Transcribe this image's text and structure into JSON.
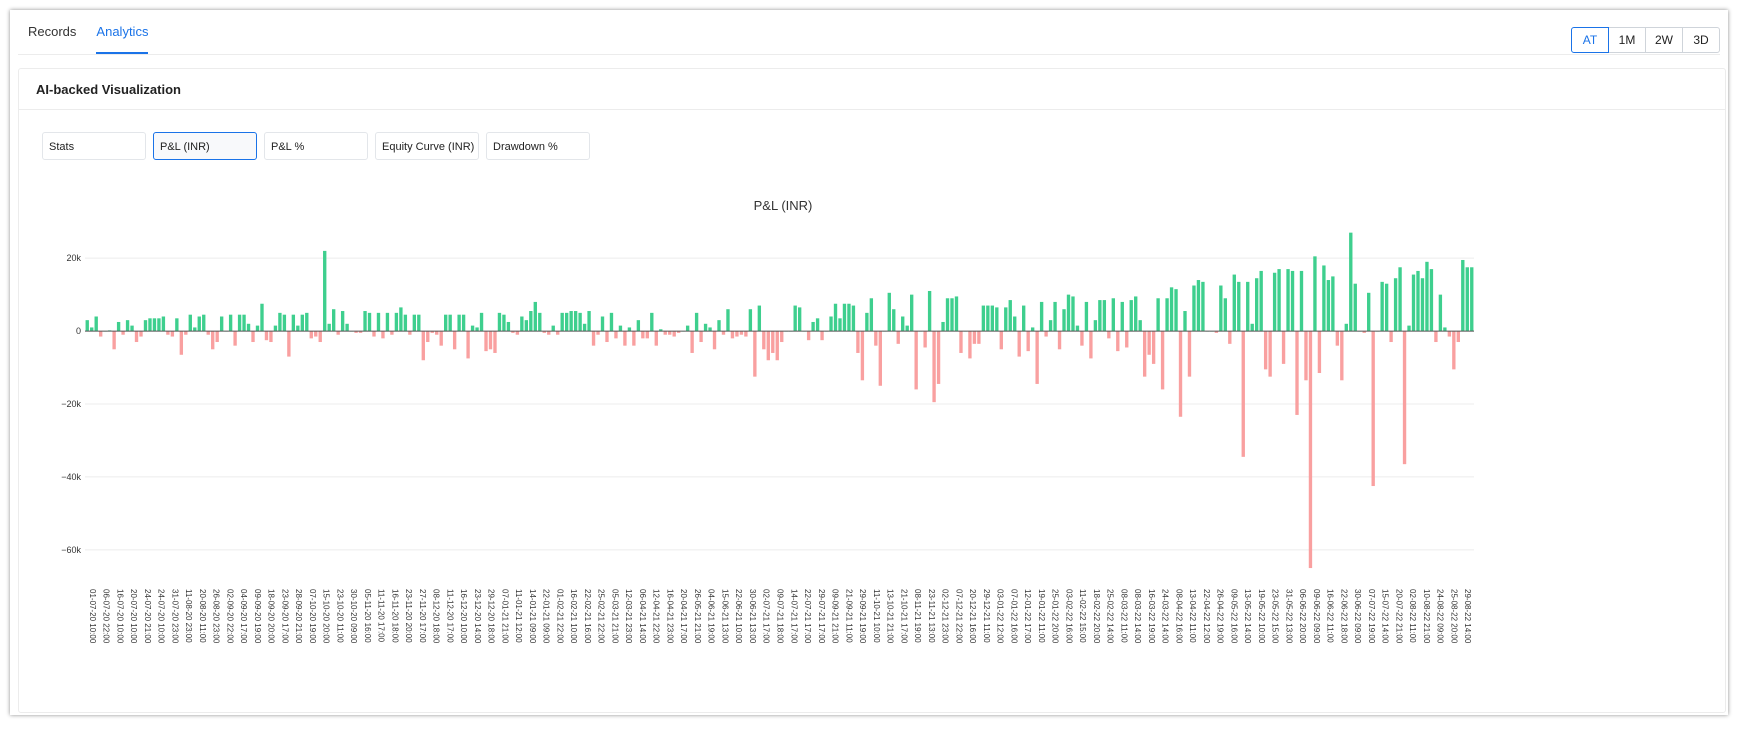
{
  "top_tabs": [
    "Records",
    "Analytics"
  ],
  "active_top_tab": 1,
  "range_buttons": [
    "AT",
    "1M",
    "2W",
    "3D"
  ],
  "active_range": 0,
  "card_title": "AI-backed Visualization",
  "sub_tabs": [
    "Stats",
    "P&L (INR)",
    "P&L %",
    "Equity Curve (INR)",
    "Drawdown %"
  ],
  "active_sub_tab": 1,
  "colors": {
    "accent": "#1a73e8",
    "positive": "#3ecf8e",
    "negative": "#f9a0a0"
  },
  "chart_data": {
    "type": "bar",
    "title": "P&L (INR)",
    "xlabel": "",
    "ylabel": "",
    "ylim": [
      -68000,
      28000
    ],
    "yticks": [
      20000,
      0,
      -20000,
      -40000,
      -60000
    ],
    "ytick_labels": [
      "20k",
      "0",
      "−20k",
      "−40k",
      "−60k"
    ],
    "grid": true,
    "xtick_labels": [
      "01-07-20 10:00",
      "06-07-20 22:00",
      "16-07-20 10:00",
      "20-07-20 10:00",
      "24-07-20 21:00",
      "24-07-20 10:00",
      "31-07-20 23:00",
      "11-08-20 23:00",
      "20-08-20 11:00",
      "26-08-20 23:00",
      "02-09-20 22:00",
      "04-09-20 17:00",
      "09-09-20 19:00",
      "18-09-20 20:00",
      "23-09-20 17:00",
      "28-09-20 21:00",
      "07-10-20 19:00",
      "15-10-20 20:00",
      "23-10-20 11:00",
      "30-10-20 09:00",
      "05-11-20 16:00",
      "11-11-20 17:00",
      "16-11-20 18:00",
      "23-11-20 20:00",
      "27-11-20 17:00",
      "08-12-20 18:00",
      "11-12-20 17:00",
      "16-12-20 10:00",
      "23-12-20 14:00",
      "29-12-20 18:00",
      "07-01-21 21:00",
      "11-01-21 12:00",
      "14-01-21 09:00",
      "22-01-21 09:00",
      "01-02-21 22:00",
      "16-02-21 10:00",
      "22-02-21 16:00",
      "25-02-21 22:00",
      "05-03-21 21:00",
      "12-03-21 23:00",
      "06-04-21 14:00",
      "12-04-21 22:00",
      "16-04-21 23:00",
      "20-04-21 17:00",
      "26-05-21 21:00",
      "04-06-21 19:00",
      "15-06-21 13:00",
      "22-06-21 10:00",
      "30-06-21 13:00",
      "02-07-21 17:00",
      "09-07-21 18:00",
      "14-07-21 17:00",
      "22-07-21 17:00",
      "29-07-21 17:00",
      "09-09-21 21:00",
      "21-09-21 11:00",
      "29-09-21 19:00",
      "11-10-21 10:00",
      "13-10-21 21:00",
      "21-10-21 17:00",
      "08-11-21 19:00",
      "23-11-21 13:00",
      "02-12-21 23:00",
      "07-12-21 22:00",
      "20-12-21 16:00",
      "29-12-21 11:00",
      "03-01-22 12:00",
      "07-01-22 16:00",
      "12-01-22 17:00",
      "19-01-22 11:00",
      "25-01-22 20:00",
      "03-02-22 16:00",
      "11-02-22 15:00",
      "18-02-22 20:00",
      "25-02-22 14:00",
      "08-03-22 11:00",
      "08-03-22 14:00",
      "16-03-22 19:00",
      "24-03-22 14:00",
      "08-04-22 16:00",
      "13-04-22 11:00",
      "22-04-22 12:00",
      "26-04-22 19:00",
      "09-05-22 16:00",
      "13-05-22 14:00",
      "19-05-22 10:00",
      "23-05-22 15:00",
      "31-05-22 13:00",
      "06-06-22 20:00",
      "09-06-22 09:00",
      "16-06-22 11:00",
      "22-06-22 18:00",
      "30-06-22 09:00",
      "07-07-22 19:00",
      "15-07-22 14:00",
      "20-07-22 21:00",
      "02-08-22 11:00",
      "10-08-22 21:00",
      "24-08-22 09:00",
      "25-08-22 20:00",
      "29-08-22 14:00"
    ],
    "values": [
      3000,
      1000,
      4000,
      -1500,
      0,
      200,
      -5000,
      2500,
      -1000,
      3000,
      1500,
      -3000,
      -1500,
      3000,
      3500,
      3500,
      3500,
      4000,
      -1000,
      -1500,
      3500,
      -6500,
      -1000,
      4500,
      1000,
      4000,
      4500,
      -1000,
      -5000,
      -3000,
      4000,
      0,
      4500,
      -4000,
      4500,
      4500,
      2000,
      -3000,
      1500,
      7500,
      -2500,
      -3000,
      1500,
      5000,
      4500,
      -7000,
      4500,
      1500,
      4500,
      5000,
      -2000,
      -1500,
      -3000,
      22000,
      2000,
      6000,
      -1000,
      5500,
      2000,
      0,
      -500,
      -500,
      5500,
      5000,
      -1500,
      5000,
      -2000,
      5000,
      -1000,
      5000,
      6500,
      4500,
      -1000,
      4500,
      4500,
      -8000,
      -3000,
      -500,
      -1000,
      -4000,
      4500,
      4500,
      -5000,
      4500,
      4500,
      -7500,
      1500,
      1000,
      5000,
      -5500,
      -5000,
      -6000,
      5000,
      4500,
      2500,
      -500,
      -1000,
      4000,
      3000,
      5500,
      8000,
      5000,
      -500,
      -1000,
      1500,
      -1000,
      5000,
      5000,
      5500,
      5500,
      5000,
      2000,
      5500,
      -4000,
      -1000,
      4000,
      -3000,
      5000,
      -2000,
      1500,
      -4000,
      1000,
      -4000,
      3000,
      -2000,
      -2000,
      5000,
      -4000,
      500,
      -1000,
      -1000,
      -1500,
      -500,
      0,
      1500,
      -6000,
      5000,
      -3000,
      2000,
      1000,
      -5000,
      3000,
      -1000,
      6000,
      -2000,
      -1500,
      -1000,
      -1500,
      6000,
      -12500,
      7000,
      -5000,
      -8000,
      -6000,
      -8000,
      -3000,
      0,
      0,
      7000,
      6500,
      0,
      -2500,
      2500,
      3500,
      -2500,
      0,
      4000,
      7500,
      3500,
      7500,
      7500,
      7000,
      -6000,
      -13500,
      5000,
      9000,
      -4000,
      -15000,
      0,
      10500,
      6000,
      -3500,
      4000,
      1500,
      10000,
      -16000,
      0,
      -4500,
      11000,
      -19500,
      -14500,
      2500,
      9000,
      9000,
      9500,
      -6000,
      0,
      -7500,
      -3500,
      -3500,
      7000,
      7000,
      7000,
      6500,
      -5000,
      6500,
      8500,
      4000,
      -7000,
      7000,
      -5500,
      1000,
      -14500,
      8000,
      -1500,
      3000,
      8000,
      -5000,
      6000,
      10000,
      9500,
      1500,
      -4000,
      8000,
      -7500,
      3000,
      8500,
      8500,
      -2000,
      9000,
      -5500,
      8000,
      -4500,
      8500,
      9500,
      3000,
      -12500,
      -6500,
      -9000,
      9000,
      -16000,
      9000,
      12000,
      11500,
      -23500,
      5500,
      -12500,
      12500,
      14000,
      13500,
      0,
      0,
      -500,
      12500,
      9000,
      -3500,
      15500,
      13500,
      -34500,
      13500,
      2000,
      14500,
      16500,
      -10500,
      -12500,
      16000,
      17000,
      -9000,
      17000,
      16500,
      -23000,
      16500,
      -13500,
      -65000,
      20500,
      -11500,
      18000,
      14000,
      15000,
      -4000,
      -13500,
      2000,
      27000,
      13000,
      0,
      -500,
      10500,
      -42500,
      0,
      13500,
      13000,
      -3000,
      14500,
      17500,
      -36500,
      1500,
      15500,
      16500,
      14500,
      19000,
      17000,
      -3000,
      10000,
      1000,
      -1500,
      -10500,
      -3000,
      19500,
      17500,
      17500
    ]
  }
}
